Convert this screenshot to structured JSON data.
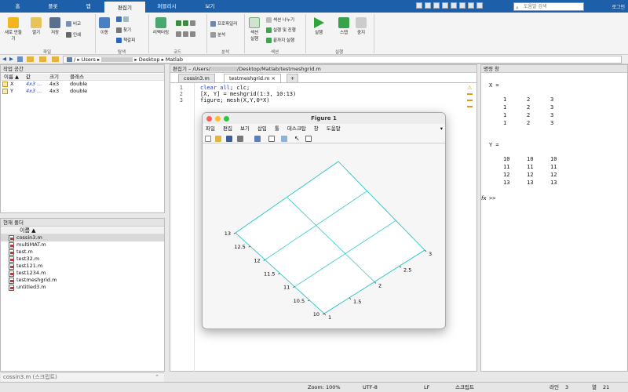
{
  "toptabs": [
    "홈",
    "플롯",
    "앱",
    "편집기",
    "퍼블리시",
    "보기"
  ],
  "search_placeholder": "도움말 검색",
  "login": "로그인",
  "ribbon": {
    "file": {
      "new": "새로 만들기",
      "open": "열기",
      "save": "저장",
      "compare": "비교",
      "print": "인쇄",
      "label": "파일"
    },
    "nav": {
      "go": "이동",
      "find": "찾기",
      "bookmark": "책갈피",
      "label": "탐색"
    },
    "code": {
      "refactor": "리팩터링",
      "label": "코드"
    },
    "analyze": {
      "profiler": "프로파일러",
      "analyze": "분석",
      "label": "분석"
    },
    "section": {
      "run_section": "섹션\n실행",
      "split": "섹션 나누기",
      "run_advance": "실행 및 진행",
      "run_end": "끝까지 실행",
      "label": "섹션"
    },
    "run": {
      "run": "실행",
      "step": "스텝",
      "stop": "중지",
      "label": "실행"
    }
  },
  "address": {
    "root": "/",
    "parts": [
      "Users",
      "",
      "Desktop",
      "Matlab"
    ]
  },
  "workspace": {
    "title": "작업 공간",
    "headers": [
      "이름 ▲",
      "값",
      "크기",
      "클래스"
    ],
    "rows": [
      {
        "name": "X",
        "value": "4x3 ...",
        "size": "4x3",
        "class": "double"
      },
      {
        "name": "Y",
        "value": "4x3 ...",
        "size": "4x3",
        "class": "double"
      }
    ]
  },
  "current_folder": {
    "title": "현재 폴더",
    "header": "이름 ▲",
    "files": [
      "cossin3.m",
      "multiMAT.m",
      "test.m",
      "test32.m",
      "test121.m",
      "test1234.m",
      "testmeshgrid.m",
      "untitled3.m"
    ],
    "details": "cossin3.m  (스크립트)"
  },
  "editor": {
    "title": "편집기 – /Users/",
    "title_suffix": "/Desktop/Matlab/testmeshgrid.m",
    "tabs": [
      "cossin3.m",
      "testmeshgrid.m",
      "+"
    ],
    "lines": [
      {
        "n": "1",
        "kw": "clear all",
        "rest": "; clc;"
      },
      {
        "n": "2",
        "kw": "",
        "rest": "[X, Y] = meshgrid(1:3, 10:13)"
      },
      {
        "n": "3",
        "kw": "",
        "rest": "figure; mesh(X,Y,0*X)"
      }
    ]
  },
  "figure": {
    "title": "Figure 1",
    "menu": [
      "파일",
      "편집",
      "보기",
      "삽입",
      "툴",
      "데스크탑",
      "창",
      "도움말"
    ],
    "y_ticks": [
      "13",
      "12.5",
      "12",
      "11.5",
      "11",
      "10.5",
      "10"
    ],
    "x_ticks": [
      "1",
      "1.5",
      "2",
      "2.5",
      "3"
    ]
  },
  "command": {
    "title": "명령 창",
    "x_label": "X =",
    "x_rows": [
      [
        "1",
        "2",
        "3"
      ],
      [
        "1",
        "2",
        "3"
      ],
      [
        "1",
        "2",
        "3"
      ],
      [
        "1",
        "2",
        "3"
      ]
    ],
    "y_label": "Y =",
    "y_rows": [
      [
        "10",
        "10",
        "10"
      ],
      [
        "11",
        "11",
        "11"
      ],
      [
        "12",
        "12",
        "12"
      ],
      [
        "13",
        "13",
        "13"
      ]
    ],
    "prompt_fx": "fx",
    "prompt": ">>"
  },
  "status": {
    "zoom": "Zoom: 100%",
    "encoding": "UTF-8",
    "eol": "LF",
    "type": "스크립트",
    "line_label": "라인",
    "line": "3",
    "col_label": "열",
    "col": "21"
  }
}
